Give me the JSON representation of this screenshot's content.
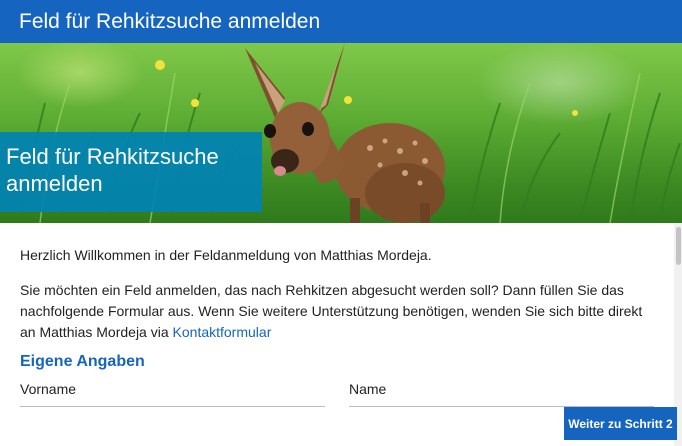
{
  "header": {
    "title": "Feld für Rehkitzsuche anmelden"
  },
  "hero": {
    "title_line1": "Feld für Rehkitzsuche",
    "title_line2": "anmelden"
  },
  "content": {
    "greeting": "Herzlich Willkommen in der Feldanmeldung von Matthias Mordeja.",
    "intro_text": "Sie möchten ein Feld anmelden, das nach Rehkitzen abgesucht werden soll? Dann füllen Sie das nachfolgende Formular aus. Wenn Sie weitere Unterstützung benötigen, wenden Sie sich bitte direkt an Matthias Mordeja via ",
    "contact_link": "Kontaktformular"
  },
  "form": {
    "section_title": "Eigene Angaben",
    "fields": {
      "firstname_label": "Vorname",
      "lastname_label": "Name"
    }
  },
  "actions": {
    "next_label": "Weiter zu Schritt 2"
  },
  "colors": {
    "primary": "#1565c0",
    "hero_overlay": "#0082b4"
  }
}
